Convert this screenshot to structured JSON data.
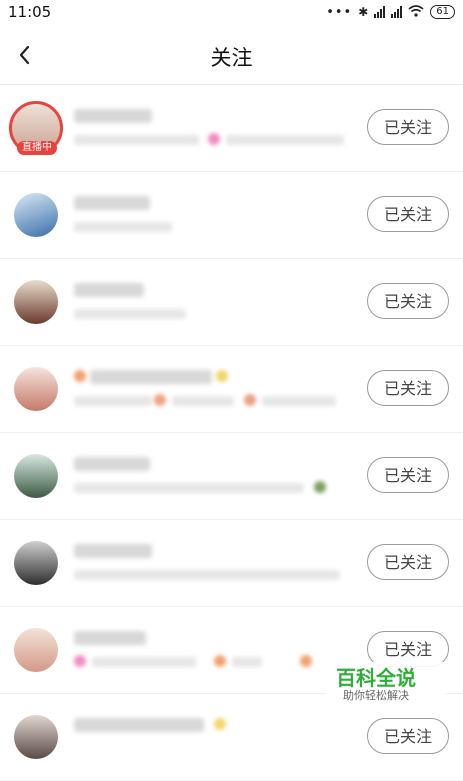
{
  "status_bar": {
    "time": "11:05",
    "dots": "•••",
    "bluetooth": "✱",
    "battery": "61"
  },
  "header": {
    "title": "关注"
  },
  "rows": [
    {
      "live_badge": "直播中",
      "button": "已关注"
    },
    {
      "button": "已关注"
    },
    {
      "button": "已关注"
    },
    {
      "button": "已关注"
    },
    {
      "button": "已关注"
    },
    {
      "button": "已关注"
    },
    {
      "button": "已关注"
    },
    {
      "button": "已关注"
    }
  ],
  "watermark": {
    "title": "百科全说",
    "subtitle": "助你轻松解决"
  },
  "colors": {
    "live": "#e8433c",
    "watermark": "#2fae3a"
  }
}
